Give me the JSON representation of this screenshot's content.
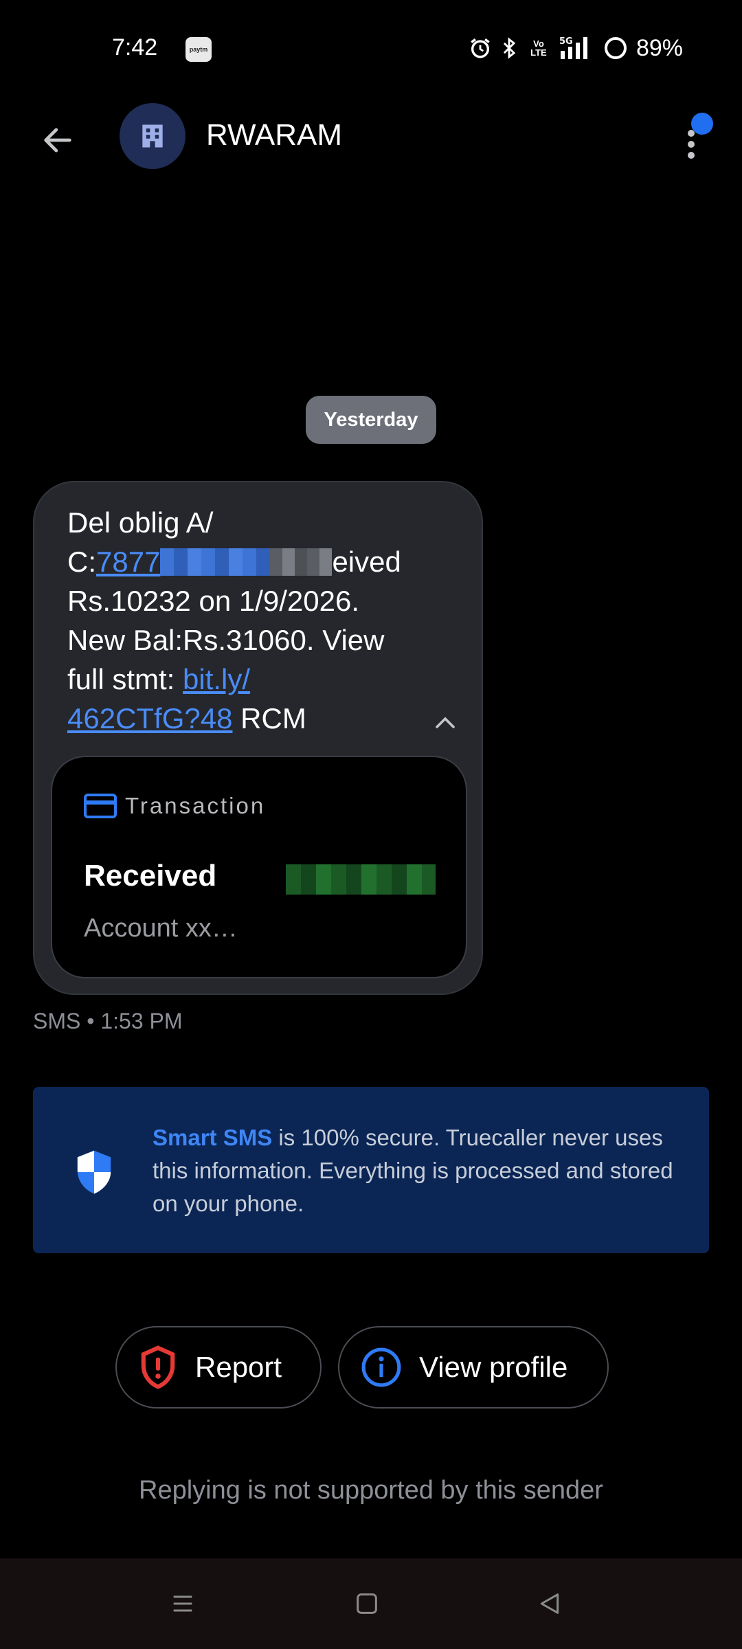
{
  "status_bar": {
    "time": "7:42",
    "app_icon_text": "paytm",
    "network_label": "5G",
    "volte_label": "Vo LTE",
    "battery": "89%"
  },
  "header": {
    "title": "RWARAM",
    "avatar_icon": "building-icon",
    "notification_color": "#1f6ff0"
  },
  "conversation": {
    "date_label": "Yesterday",
    "message": {
      "line1": "Del oblig A/",
      "line2_prefix": "C:",
      "account_link": "7877",
      "line2_suffix": "eived",
      "line3": "Rs.10232 on 1/9/2026.",
      "line4": "New Bal:Rs.31060. View",
      "line5_prefix": "full stmt: ",
      "url_part1": "bit.ly/",
      "url_part2": "462CTfG?48",
      "line6_suffix": " RCM"
    },
    "transaction_card": {
      "header_label": "Transaction",
      "title": "Received",
      "account": "Account xx…"
    },
    "meta": "SMS • 1:53 PM"
  },
  "banner": {
    "highlight": "Smart SMS",
    "text": " is 100% secure. Truecaller never uses this information. Everything is processed and stored on your phone."
  },
  "actions": {
    "report": "Report",
    "view_profile": "View profile"
  },
  "reply_note": "Replying is not supported by this sender",
  "colors": {
    "accent_blue": "#3f86f5",
    "report_red": "#e53935",
    "banner_bg": "#0b2655"
  }
}
